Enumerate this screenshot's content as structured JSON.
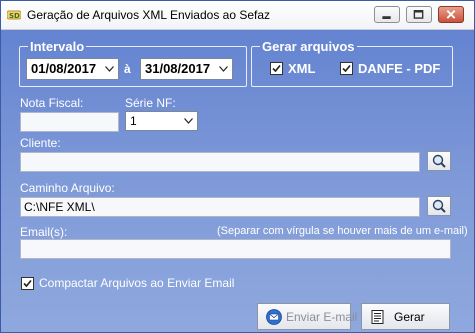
{
  "window": {
    "title": "Geração de Arquivos XML Enviados ao Sefaz"
  },
  "intervalo": {
    "legend": "Intervalo",
    "start_date": "01/08/2017",
    "separator": "à",
    "end_date": "31/08/2017"
  },
  "gerar_arquivos": {
    "legend": "Gerar arquivos",
    "xml_label": "XML",
    "xml_checked": true,
    "pdf_label": "DANFE - PDF",
    "pdf_checked": true
  },
  "nota_fiscal": {
    "label": "Nota Fiscal:",
    "value": ""
  },
  "serie_nf": {
    "label": "Série NF:",
    "value": "1"
  },
  "cliente": {
    "label": "Cliente:",
    "value": ""
  },
  "caminho": {
    "label": "Caminho Arquivo:",
    "value": "C:\\NFE XML\\"
  },
  "emails": {
    "label": "Email(s):",
    "hint": "(Separar com vírgula se houver mais de um e-mail)",
    "value": ""
  },
  "compactar": {
    "label": "Compactar Arquivos ao Enviar Email",
    "checked": true
  },
  "buttons": {
    "enviar_email": "Enviar E-mail",
    "gerar": "Gerar"
  }
}
